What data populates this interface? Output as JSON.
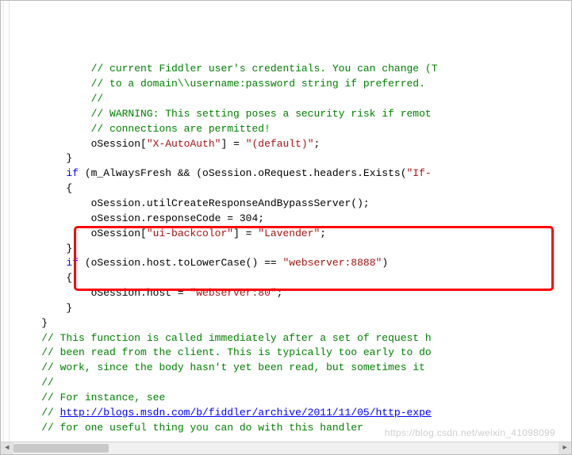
{
  "code": {
    "lines": [
      {
        "indent": "            ",
        "segments": [
          {
            "cls": "c-comment",
            "text": "// current Fiddler user's credentials. You can change (T"
          }
        ]
      },
      {
        "indent": "            ",
        "segments": [
          {
            "cls": "c-comment",
            "text": "// to a domain\\\\username:password string if preferred."
          }
        ]
      },
      {
        "indent": "            ",
        "segments": [
          {
            "cls": "c-comment",
            "text": "//"
          }
        ]
      },
      {
        "indent": "            ",
        "segments": [
          {
            "cls": "c-comment",
            "text": "// WARNING: This setting poses a security risk if remot"
          }
        ]
      },
      {
        "indent": "            ",
        "segments": [
          {
            "cls": "c-comment",
            "text": "// connections are permitted!"
          }
        ]
      },
      {
        "indent": "            ",
        "segments": [
          {
            "cls": "",
            "text": "oSession["
          },
          {
            "cls": "c-string",
            "text": "\"X-AutoAuth\""
          },
          {
            "cls": "",
            "text": "] = "
          },
          {
            "cls": "c-string",
            "text": "\"(default)\""
          },
          {
            "cls": "",
            "text": ";"
          }
        ]
      },
      {
        "indent": "        ",
        "segments": [
          {
            "cls": "",
            "text": "}"
          }
        ]
      },
      {
        "indent": "",
        "segments": [
          {
            "cls": "",
            "text": ""
          }
        ]
      },
      {
        "indent": "        ",
        "segments": [
          {
            "cls": "c-keyword",
            "text": "if"
          },
          {
            "cls": "",
            "text": " (m_AlwaysFresh && (oSession.oRequest.headers.Exists("
          },
          {
            "cls": "c-string",
            "text": "\"If-"
          }
        ]
      },
      {
        "indent": "        ",
        "segments": [
          {
            "cls": "",
            "text": "{"
          }
        ]
      },
      {
        "indent": "            ",
        "segments": [
          {
            "cls": "",
            "text": "oSession.utilCreateResponseAndBypassServer();"
          }
        ]
      },
      {
        "indent": "            ",
        "segments": [
          {
            "cls": "",
            "text": "oSession.responseCode = 304;"
          }
        ]
      },
      {
        "indent": "            ",
        "segments": [
          {
            "cls": "",
            "text": "oSession["
          },
          {
            "cls": "c-string",
            "text": "\"ui-backcolor\""
          },
          {
            "cls": "",
            "text": "] = "
          },
          {
            "cls": "c-string",
            "text": "\"Lavender\""
          },
          {
            "cls": "",
            "text": ";"
          }
        ]
      },
      {
        "indent": "        ",
        "segments": [
          {
            "cls": "",
            "text": "}"
          }
        ]
      },
      {
        "indent": "        ",
        "segments": [
          {
            "cls": "c-keyword",
            "text": "if"
          },
          {
            "cls": "",
            "text": " (oSession.host.toLowerCase() == "
          },
          {
            "cls": "c-string",
            "text": "\"webserver:8888\""
          },
          {
            "cls": "",
            "text": ")"
          }
        ]
      },
      {
        "indent": "        ",
        "segments": [
          {
            "cls": "",
            "text": "{"
          }
        ]
      },
      {
        "indent": "            ",
        "segments": [
          {
            "cls": "",
            "text": "oSession.host = "
          },
          {
            "cls": "c-string",
            "text": "\"webserver:80\""
          },
          {
            "cls": "",
            "text": ";"
          }
        ]
      },
      {
        "indent": "        ",
        "segments": [
          {
            "cls": "",
            "text": "}"
          }
        ]
      },
      {
        "indent": "",
        "segments": [
          {
            "cls": "",
            "text": ""
          }
        ]
      },
      {
        "indent": "    ",
        "segments": [
          {
            "cls": "",
            "text": "}"
          }
        ]
      },
      {
        "indent": "",
        "segments": [
          {
            "cls": "",
            "text": ""
          }
        ]
      },
      {
        "indent": "    ",
        "segments": [
          {
            "cls": "c-comment",
            "text": "// This function is called immediately after a set of request h"
          }
        ]
      },
      {
        "indent": "    ",
        "segments": [
          {
            "cls": "c-comment",
            "text": "// been read from the client. This is typically too early to do "
          }
        ]
      },
      {
        "indent": "    ",
        "segments": [
          {
            "cls": "c-comment",
            "text": "// work, since the body hasn't yet been read, but sometimes it "
          }
        ]
      },
      {
        "indent": "    ",
        "segments": [
          {
            "cls": "c-comment",
            "text": "//"
          }
        ]
      },
      {
        "indent": "    ",
        "segments": [
          {
            "cls": "c-comment",
            "text": "// For instance, see"
          }
        ]
      },
      {
        "indent": "    ",
        "segments": [
          {
            "cls": "c-comment",
            "text": "// "
          },
          {
            "cls": "c-link",
            "text": "http://blogs.msdn.com/b/fiddler/archive/2011/11/05/http-expe"
          }
        ]
      },
      {
        "indent": "    ",
        "segments": [
          {
            "cls": "c-comment",
            "text": "// for one useful thing you can do with this handler"
          }
        ]
      }
    ]
  },
  "watermark": "https://blog.csdn.net/weixin_41098099",
  "scroll": {
    "leftArrow": "◄",
    "rightArrow": "►"
  }
}
